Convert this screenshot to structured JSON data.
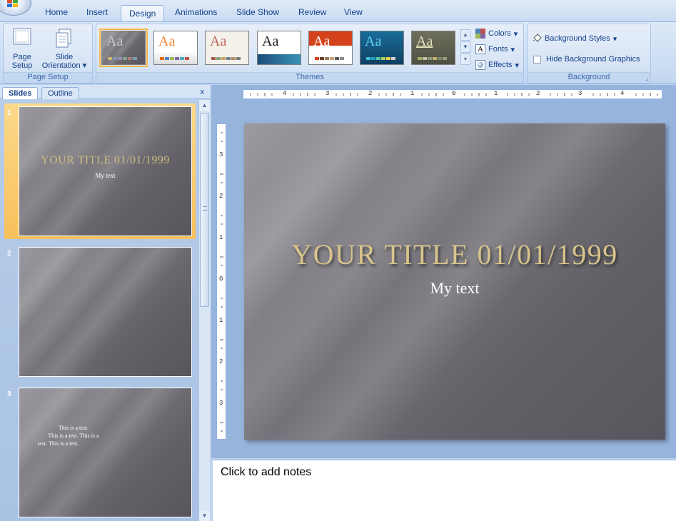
{
  "ribbon_tabs": [
    "Home",
    "Insert",
    "Design",
    "Animations",
    "Slide Show",
    "Review",
    "View"
  ],
  "active_tab": "Design",
  "page_setup": {
    "page_setup_label": "Page\nSetup",
    "page_setup_l1": "Page",
    "page_setup_l2": "Setup",
    "orientation_l1": "Slide",
    "orientation_l2": "Orientation",
    "group_label": "Page Setup"
  },
  "themes": {
    "group_label": "Themes",
    "sample_text": "Aa",
    "colors_label": "Colors",
    "fonts_label": "Fonts",
    "effects_label": "Effects"
  },
  "background": {
    "styles_label": "Background Styles",
    "hide_graphics_label": "Hide Background Graphics",
    "hide_graphics_checked": false,
    "group_label": "Background"
  },
  "slides_pane": {
    "tab_slides": "Slides",
    "tab_outline": "Outline",
    "close_glyph": "x",
    "slides": [
      {
        "number": "1",
        "title": "YOUR TITLE 01/01/1999",
        "subtitle": "My text"
      },
      {
        "number": "2"
      },
      {
        "number": "3",
        "body_line1": "This is a test.",
        "body_line2": "This is a test. This is a",
        "body_line3": "test. This is a test."
      }
    ]
  },
  "ruler": {
    "h_labels": [
      "4",
      "3",
      "2",
      "1",
      "0",
      "1",
      "2",
      "3",
      "4"
    ],
    "v_labels": [
      "3",
      "2",
      "1",
      "0",
      "1",
      "2",
      "3"
    ]
  },
  "main_slide": {
    "title": "YOUR TITLE 01/01/1999",
    "subtitle": "My text"
  },
  "notes": {
    "placeholder": "Click to add notes"
  }
}
